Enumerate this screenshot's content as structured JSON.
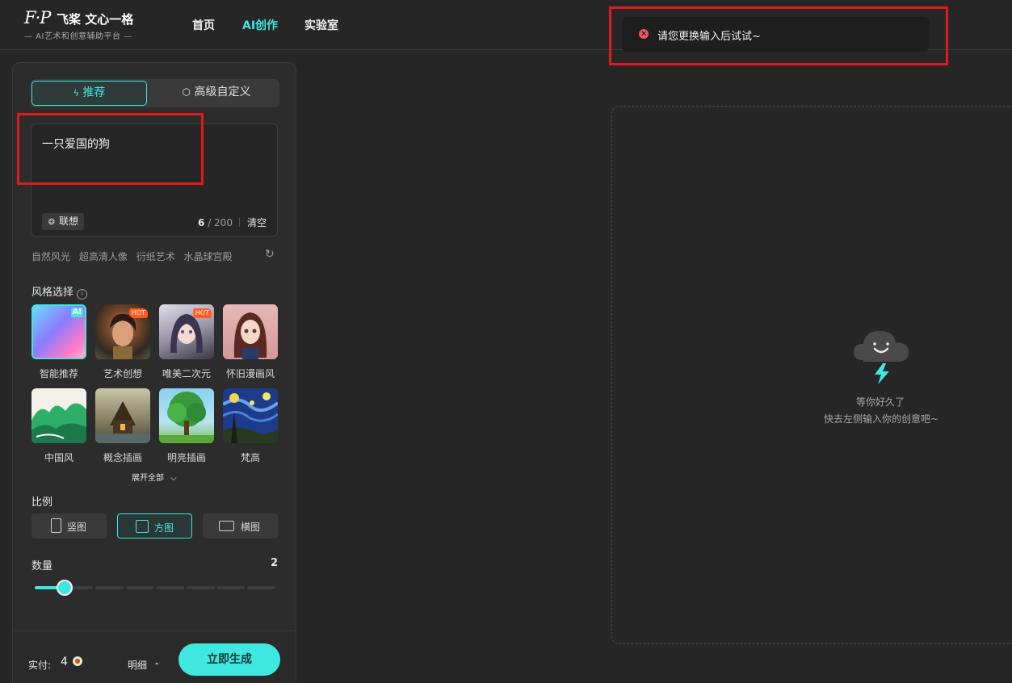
{
  "header": {
    "logo_mark": "F·P",
    "logo_title": "飞桨 文心一格",
    "logo_subtitle": "— AI艺术和创意辅助平台 —",
    "nav": [
      {
        "label": "首页",
        "active": false
      },
      {
        "label": "AI创作",
        "active": true
      },
      {
        "label": "实验室",
        "active": false
      }
    ]
  },
  "toast": {
    "icon": "error-icon",
    "message": "请您更换输入后试试~"
  },
  "mode_tabs": {
    "recommend": "推荐",
    "advanced": "高级自定义"
  },
  "prompt": {
    "value": "一只爱国的狗",
    "count": "6",
    "max": "/ 200",
    "clear_label": "清空",
    "assoc_label": "联想"
  },
  "suggest_tags": [
    "自然风光",
    "超高清人像",
    "衍纸艺术",
    "水晶球宫殿"
  ],
  "style_section": {
    "label": "风格选择",
    "items": [
      {
        "name": "智能推荐",
        "badge": "AI",
        "selected": true
      },
      {
        "name": "艺术创想",
        "badge": "HOT",
        "selected": false
      },
      {
        "name": "唯美二次元",
        "badge": "HOT",
        "selected": false
      },
      {
        "name": "怀旧漫画风",
        "badge": "",
        "selected": false
      },
      {
        "name": "中国风",
        "badge": "",
        "selected": false
      },
      {
        "name": "概念插画",
        "badge": "",
        "selected": false
      },
      {
        "name": "明亮插画",
        "badge": "",
        "selected": false
      },
      {
        "name": "梵高",
        "badge": "",
        "selected": false
      }
    ],
    "expand_label": "展开全部"
  },
  "ratio_section": {
    "label": "比例",
    "options": [
      {
        "label": "竖图",
        "selected": false
      },
      {
        "label": "方图",
        "selected": true
      },
      {
        "label": "横图",
        "selected": false
      }
    ]
  },
  "quantity_section": {
    "label": "数量",
    "value": "2",
    "min": 1,
    "max": 9
  },
  "footer": {
    "pay_label": "实付:",
    "pay_value": "4",
    "detail_label": "明细",
    "generate_label": "立即生成"
  },
  "empty_state": {
    "line1": "等你好久了",
    "line2": "快去左侧输入你的创意吧~"
  },
  "colors": {
    "accent": "#3ee8e0",
    "error": "#f05656",
    "hot": "#ff5a1f",
    "background": "#262626"
  }
}
